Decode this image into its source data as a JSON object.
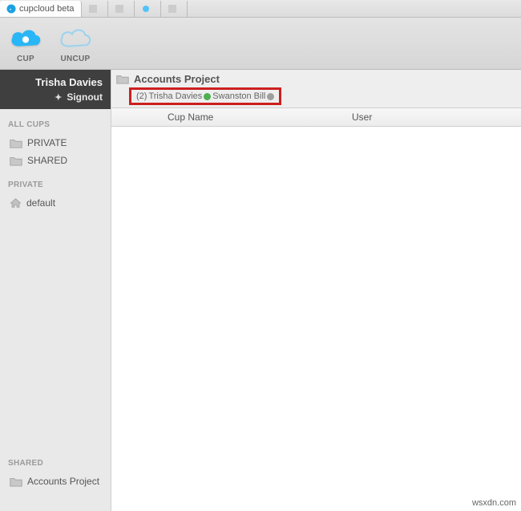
{
  "browser": {
    "tabs": [
      {
        "title": "cupcloud beta",
        "active": true
      },
      {
        "title": " ",
        "active": false
      },
      {
        "title": " ",
        "active": false
      },
      {
        "title": " ",
        "active": false
      },
      {
        "title": " ",
        "active": false
      }
    ]
  },
  "toolbar": {
    "cup_label": "CUP",
    "uncup_label": "UNCUP"
  },
  "user": {
    "name": "Trisha Davies",
    "signout_label": "Signout"
  },
  "sections": {
    "allcups_label": "ALL CUPS",
    "private_label": "PRIVATE",
    "shared_label": "SHARED"
  },
  "nav": {
    "private": "PRIVATE",
    "shared": "SHARED",
    "default_item": "default",
    "accounts_project": "Accounts Project"
  },
  "content": {
    "title": "Accounts Project",
    "users_prefix": "(2)",
    "user1": "Trisha Davies",
    "user2": "Swanston Bill",
    "columns": {
      "cupname": "Cup Name",
      "user": "User"
    }
  },
  "watermark": "wsxdn.com"
}
